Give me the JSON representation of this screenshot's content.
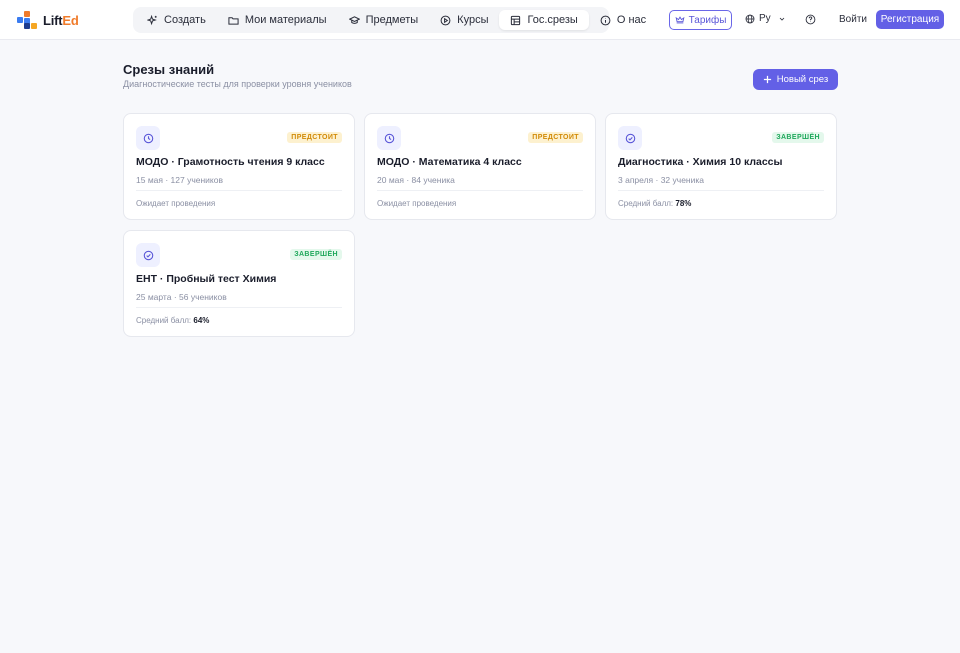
{
  "brand": {
    "name_part1": "Lift",
    "name_part2": "Ed"
  },
  "nav": {
    "items": [
      {
        "label": "Создать",
        "icon": "sparkle-icon"
      },
      {
        "label": "Мои материалы",
        "icon": "folder-icon"
      },
      {
        "label": "Предметы",
        "icon": "graduation-cap-icon"
      },
      {
        "label": "Курсы",
        "icon": "play-circle-icon"
      },
      {
        "label": "Гос.срезы",
        "icon": "grid-doc-icon",
        "active": true
      },
      {
        "label": "О нас",
        "icon": "info-icon"
      }
    ]
  },
  "header": {
    "tariffs_label": "Тарифы",
    "lang_label": "Ру",
    "login_label": "Войти",
    "register_label": "Регистрация"
  },
  "page": {
    "title": "Срезы знаний",
    "subtitle": "Диагностические тесты для проверки уровня учеников",
    "new_button_label": "Новый срез"
  },
  "cards": [
    {
      "title": "МОДО · Грамотность чтения 9 класс",
      "meta": "15 мая · 127 учеников",
      "status": "ПРЕДСТОИТ",
      "status_type": "upcoming",
      "icon": "clock-icon",
      "footer": "Ожидает проведения"
    },
    {
      "title": "МОДО · Математика 4 класс",
      "meta": "20 мая · 84 ученика",
      "status": "ПРЕДСТОИТ",
      "status_type": "upcoming",
      "icon": "clock-icon",
      "footer": "Ожидает проведения"
    },
    {
      "title": "Диагностика · Химия 10 классы",
      "meta": "3 апреля · 32 ученика",
      "status": "ЗАВЕРШЁН",
      "status_type": "done",
      "icon": "check-circle-icon",
      "footer_label": "Средний балл:",
      "footer_value": "78%"
    },
    {
      "title": "ЕНТ · Пробный тест Химия",
      "meta": "25 марта · 56 учеников",
      "status": "ЗАВЕРШЁН",
      "status_type": "done",
      "icon": "check-circle-icon",
      "footer_label": "Средний балл:",
      "footer_value": "64%"
    }
  ],
  "colors": {
    "accent": "#6360e6",
    "upcoming_text": "#d18a07",
    "upcoming_bg": "#fdf1cf",
    "done_text": "#1fa85b",
    "done_bg": "#e4f8ec",
    "brand_orange": "#f07b2a"
  }
}
